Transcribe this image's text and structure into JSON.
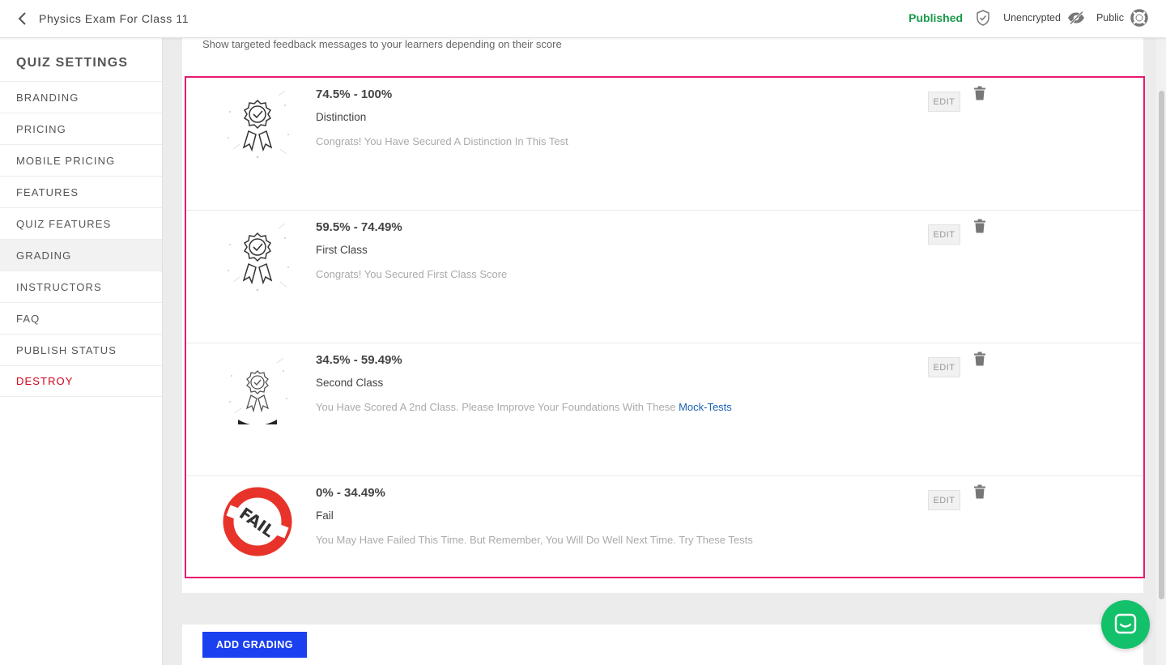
{
  "header": {
    "title": "Physics Exam For Class 11",
    "status": "Published",
    "encryption": "Unencrypted",
    "visibility": "Public"
  },
  "sidebar": {
    "heading": "QUIZ SETTINGS",
    "items": [
      {
        "label": "BRANDING"
      },
      {
        "label": "PRICING"
      },
      {
        "label": "MOBILE PRICING"
      },
      {
        "label": "FEATURES"
      },
      {
        "label": "QUIZ FEATURES"
      },
      {
        "label": "GRADING",
        "active": true
      },
      {
        "label": "INSTRUCTORS"
      },
      {
        "label": "FAQ"
      },
      {
        "label": "PUBLISH STATUS"
      },
      {
        "label": "DESTROY",
        "danger": true
      }
    ]
  },
  "main": {
    "subtitle": "Show targeted feedback messages to your learners depending on their score",
    "edit_label": "EDIT",
    "grades": [
      {
        "range": "74.5% - 100%",
        "name": "Distinction",
        "message": "Congrats! You Have Secured A Distinction In This Test",
        "link": "",
        "icon": "award-badge-icon"
      },
      {
        "range": "59.5% - 74.49%",
        "name": "First Class",
        "message": "Congrats! You Secured First Class Score",
        "link": "",
        "icon": "award-badge-icon"
      },
      {
        "range": "34.5% - 59.49%",
        "name": "Second Class",
        "message": "You Have Scored A 2nd Class. Please Improve Your Foundations With These",
        "link": "Mock-Tests",
        "icon": "award-badge-icon"
      },
      {
        "range": "0% - 34.49%",
        "name": "Fail",
        "message": "You May Have Failed This Time. But Remember, You Will Do Well Next Time. Try These Tests",
        "link": "",
        "icon": "fail-stamp-icon",
        "stamp_text": "FAIL"
      }
    ],
    "add_button": "ADD GRADING"
  },
  "colors": {
    "published": "#1a9a4a",
    "highlight": "#e8196f",
    "primary": "#1a40f0",
    "danger": "#d0021b",
    "chat": "#13c16b"
  }
}
